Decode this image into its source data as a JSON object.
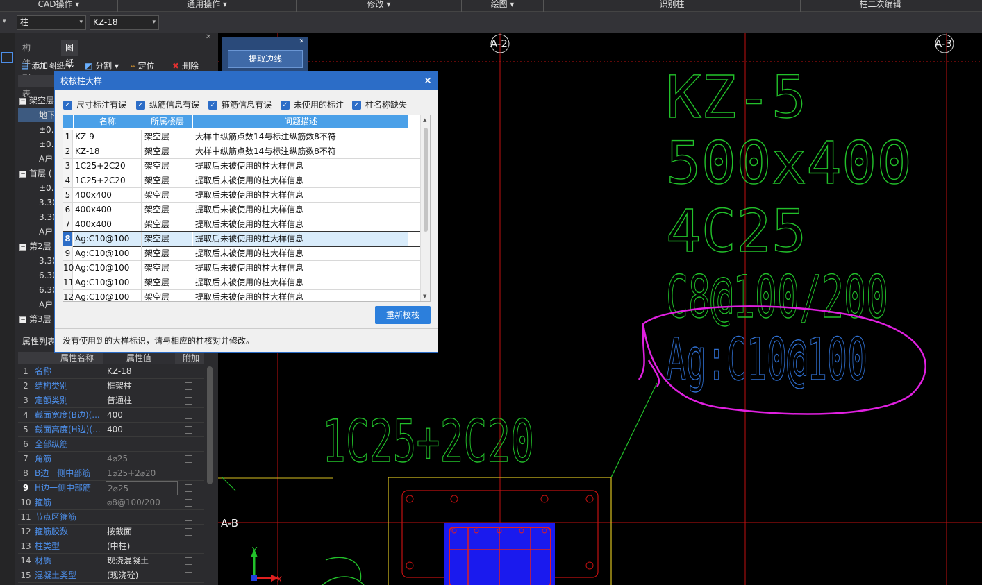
{
  "ribbon": {
    "items": [
      "CAD操作 ▾",
      "通用操作 ▾",
      "修改 ▾",
      "绘图 ▾",
      "识别柱",
      "柱二次编辑"
    ]
  },
  "toolbar2": {
    "component_type": "柱",
    "component_name": "KZ-18"
  },
  "left_panel": {
    "tabs": [
      "构件列表",
      "图纸管理"
    ],
    "actions": [
      "添加图纸 ▾",
      "分割 ▾",
      "定位",
      "删除"
    ],
    "tree": [
      {
        "label": "架空层",
        "expander": "−"
      },
      {
        "label": "地下",
        "expander": ""
      },
      {
        "label": "±0.0",
        "expander": ""
      },
      {
        "label": "±0.0",
        "expander": ""
      },
      {
        "label": "A户",
        "expander": ""
      },
      {
        "label": "首层 (",
        "expander": "−"
      },
      {
        "label": "±0.0",
        "expander": ""
      },
      {
        "label": "3.30",
        "expander": ""
      },
      {
        "label": "3.30",
        "expander": ""
      },
      {
        "label": "A户",
        "expander": ""
      },
      {
        "label": "第2层",
        "expander": "−"
      },
      {
        "label": "3.30",
        "expander": ""
      },
      {
        "label": "6.30",
        "expander": ""
      },
      {
        "label": "6.30",
        "expander": ""
      },
      {
        "label": "A户",
        "expander": ""
      },
      {
        "label": "第3层",
        "expander": "−"
      }
    ]
  },
  "properties": {
    "title": "属性列表",
    "headers": [
      "属性名称",
      "属性值",
      "附加"
    ],
    "rows": [
      {
        "n": "1",
        "k": "名称",
        "v": "KZ-18",
        "dim": false
      },
      {
        "n": "2",
        "k": "结构类别",
        "v": "框架柱",
        "dim": false
      },
      {
        "n": "3",
        "k": "定额类别",
        "v": "普通柱",
        "dim": false
      },
      {
        "n": "4",
        "k": "截面宽度(B边)(...",
        "v": "400",
        "dim": false
      },
      {
        "n": "5",
        "k": "截面高度(H边)(...",
        "v": "400",
        "dim": false
      },
      {
        "n": "6",
        "k": "全部纵筋",
        "v": "",
        "dim": false
      },
      {
        "n": "7",
        "k": "角筋",
        "v": "4⌀25",
        "dim": true
      },
      {
        "n": "8",
        "k": "B边一侧中部筋",
        "v": "1⌀25+2⌀20",
        "dim": true
      },
      {
        "n": "9",
        "k": "H边一侧中部筋",
        "v": "2⌀25",
        "dim": true
      },
      {
        "n": "10",
        "k": "箍筋",
        "v": "⌀8@100/200",
        "dim": true
      },
      {
        "n": "11",
        "k": "节点区箍筋",
        "v": "",
        "dim": false
      },
      {
        "n": "12",
        "k": "箍筋胶数",
        "v": "按截面",
        "dim": false
      },
      {
        "n": "13",
        "k": "柱类型",
        "v": "(中柱)",
        "dim": false
      },
      {
        "n": "14",
        "k": "材质",
        "v": "现浇混凝土",
        "dim": false
      },
      {
        "n": "15",
        "k": "混凝土类型",
        "v": "(现浇砼)",
        "dim": false
      }
    ]
  },
  "mini_panel": {
    "extract_label": "提取边线"
  },
  "dialog": {
    "title": "校核柱大样",
    "close": "✕",
    "filters": [
      "尺寸标注有误",
      "纵筋信息有误",
      "箍筋信息有误",
      "未使用的标注",
      "柱名称缺失"
    ],
    "grid_headers": [
      "名称",
      "所属楼层",
      "问题描述"
    ],
    "rows": [
      {
        "n": "1",
        "name": "KZ-9",
        "floor": "架空层",
        "desc": "大样中纵筋点数14与标注纵筋数8不符"
      },
      {
        "n": "2",
        "name": "KZ-18",
        "floor": "架空层",
        "desc": "大样中纵筋点数14与标注纵筋数8不符"
      },
      {
        "n": "3",
        "name": "1C25+2C20",
        "floor": "架空层",
        "desc": "提取后未被使用的柱大样信息"
      },
      {
        "n": "4",
        "name": "1C25+2C20",
        "floor": "架空层",
        "desc": "提取后未被使用的柱大样信息"
      },
      {
        "n": "5",
        "name": "400x400",
        "floor": "架空层",
        "desc": "提取后未被使用的柱大样信息"
      },
      {
        "n": "6",
        "name": "400x400",
        "floor": "架空层",
        "desc": "提取后未被使用的柱大样信息"
      },
      {
        "n": "7",
        "name": "400x400",
        "floor": "架空层",
        "desc": "提取后未被使用的柱大样信息"
      },
      {
        "n": "8",
        "name": "Ag:C10@100",
        "floor": "架空层",
        "desc": "提取后未被使用的柱大样信息"
      },
      {
        "n": "9",
        "name": "Ag:C10@100",
        "floor": "架空层",
        "desc": "提取后未被使用的柱大样信息"
      },
      {
        "n": "10",
        "name": "Ag:C10@100",
        "floor": "架空层",
        "desc": "提取后未被使用的柱大样信息"
      },
      {
        "n": "11",
        "name": "Ag:C10@100",
        "floor": "架空层",
        "desc": "提取后未被使用的柱大样信息"
      },
      {
        "n": "12",
        "name": "Ag:C10@100",
        "floor": "架空层",
        "desc": "提取后未被使用的柱大样信息"
      }
    ],
    "selected_row": 8,
    "recheck_label": "重新校核",
    "status": "没有使用到的大样标识，请与相应的柱核对并修改。"
  },
  "cad": {
    "axis_labels": [
      "A-2",
      "A-3",
      "A-B"
    ],
    "annotations": [
      "KZ-5",
      "500x400",
      "4C25",
      "C8@100/200",
      "Ag:C10@100",
      "1C25+2C20"
    ],
    "ucs": {
      "x": "X",
      "y": "Y"
    },
    "colors": {
      "text_green": "#22c02a",
      "text_blue": "#2f6fd0",
      "circle_magenta": "#e020e0",
      "axis_red": "#c01010",
      "outline_yellow": "#d8c020",
      "fill_blue": "#1a1aee"
    }
  }
}
